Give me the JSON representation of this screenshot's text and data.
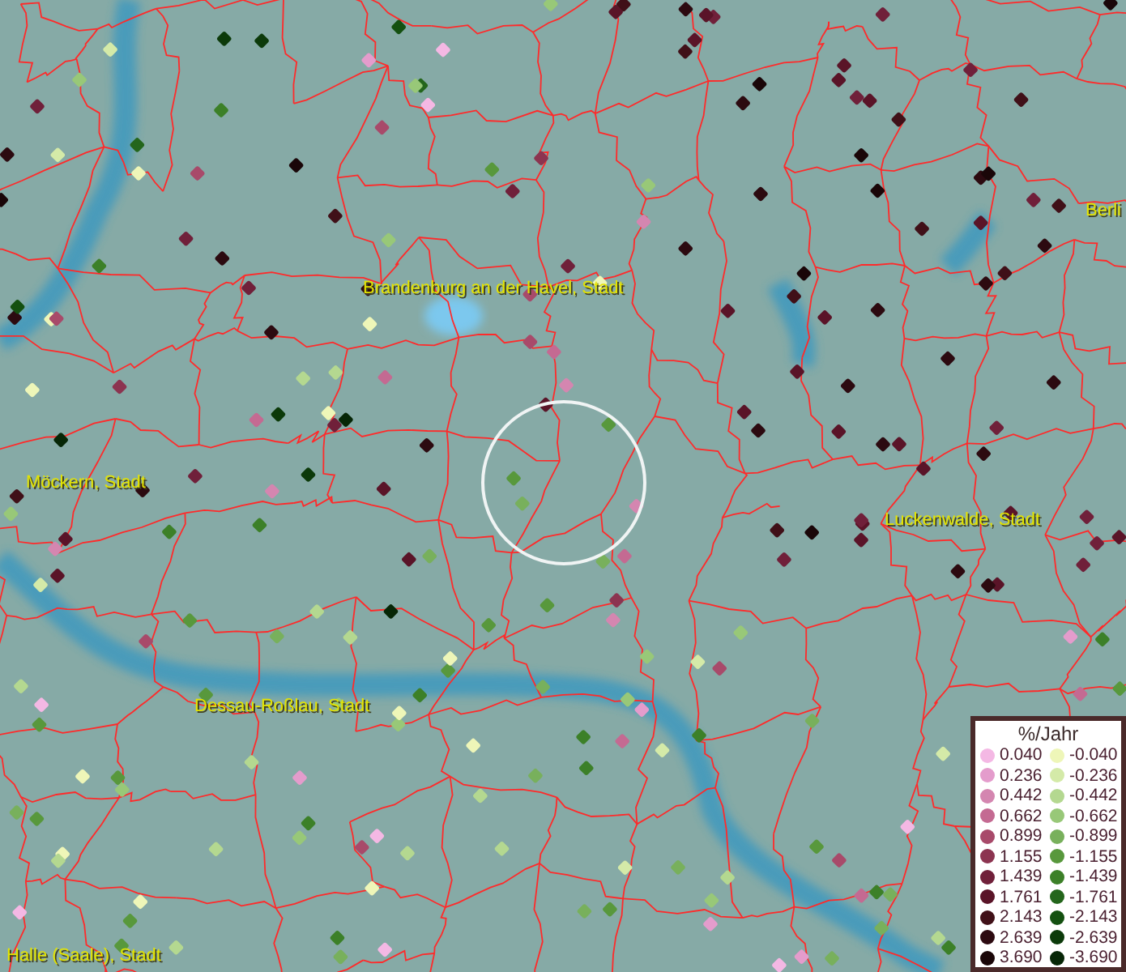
{
  "map": {
    "places": [
      {
        "name": "Brandenburg an der Havel, Stadt"
      },
      {
        "name": "Berli"
      },
      {
        "name": "Möckern, Stadt"
      },
      {
        "name": "Luckenwalde, Stadt"
      },
      {
        "name": "Dessau-Roßlau, Stadt"
      },
      {
        "name": "Halle (Saale), Stadt"
      }
    ]
  },
  "legend": {
    "title": "%/Jahr",
    "entries": [
      {
        "label": "0.040",
        "color": "#f4b8e4"
      },
      {
        "label": "-0.040",
        "color": "#eef6b8"
      },
      {
        "label": "0.236",
        "color": "#e49ccc"
      },
      {
        "label": "-0.236",
        "color": "#d4eaa8"
      },
      {
        "label": "0.442",
        "color": "#d486b0"
      },
      {
        "label": "-0.442",
        "color": "#b4d890"
      },
      {
        "label": "0.662",
        "color": "#c46a92"
      },
      {
        "label": "-0.662",
        "color": "#98c878"
      },
      {
        "label": "0.899",
        "color": "#a84a6a"
      },
      {
        "label": "-0.899",
        "color": "#78b05c"
      },
      {
        "label": "1.155",
        "color": "#8c3450"
      },
      {
        "label": "-1.155",
        "color": "#58983c"
      },
      {
        "label": "1.439",
        "color": "#70203a"
      },
      {
        "label": "-1.439",
        "color": "#3c8028"
      },
      {
        "label": "1.761",
        "color": "#5a1428"
      },
      {
        "label": "-1.761",
        "color": "#24661c"
      },
      {
        "label": "2.143",
        "color": "#401018"
      },
      {
        "label": "-2.143",
        "color": "#145010"
      },
      {
        "label": "2.639",
        "color": "#2c0a10"
      },
      {
        "label": "-2.639",
        "color": "#0c3a0a"
      },
      {
        "label": "3.690",
        "color": "#1a0608"
      },
      {
        "label": "-3.690",
        "color": "#062606"
      }
    ]
  }
}
